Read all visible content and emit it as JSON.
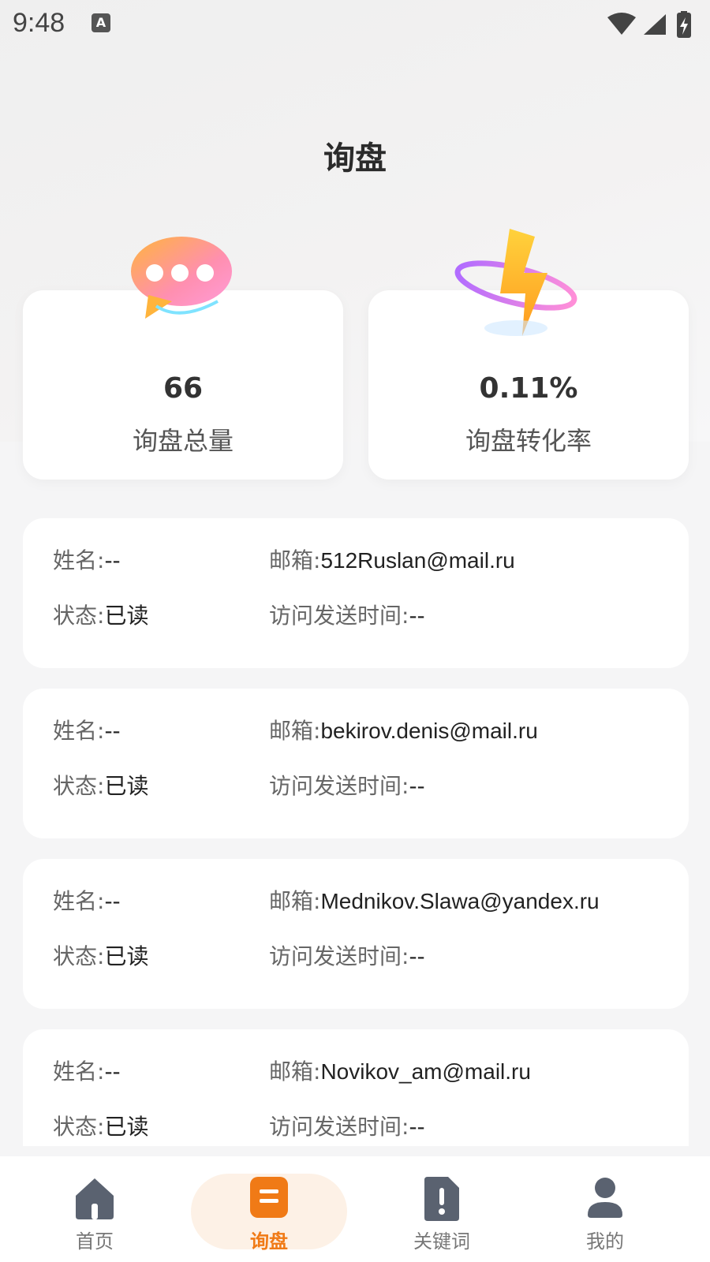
{
  "status_bar": {
    "time": "9:48",
    "indicator": "A"
  },
  "header": {
    "title": "询盘"
  },
  "stats": [
    {
      "value": "66",
      "label": "询盘总量",
      "icon": "chat-bubble-icon"
    },
    {
      "value": "0.11%",
      "label": "询盘转化率",
      "icon": "lightning-icon"
    }
  ],
  "field_labels": {
    "name": "姓名:",
    "email": "邮箱:",
    "status": "状态:",
    "time": "访问发送时间:"
  },
  "records": [
    {
      "name": "--",
      "email": "512Ruslan@mail.ru",
      "status": "已读",
      "time": "--"
    },
    {
      "name": "--",
      "email": "bekirov.denis@mail.ru",
      "status": "已读",
      "time": "--"
    },
    {
      "name": "--",
      "email": "Mednikov.Slawa@yandex.ru",
      "status": "已读",
      "time": "--"
    },
    {
      "name": "--",
      "email": "Novikov_am@mail.ru",
      "status": "已读",
      "time": "--"
    }
  ],
  "nav": {
    "items": [
      {
        "label": "首页",
        "icon": "home-icon"
      },
      {
        "label": "询盘",
        "icon": "inquiry-icon",
        "active": true
      },
      {
        "label": "关键词",
        "icon": "keyword-icon"
      },
      {
        "label": "我的",
        "icon": "user-icon"
      }
    ]
  },
  "colors": {
    "accent": "#f07a16",
    "nav_inactive": "#5a6270",
    "active_bg": "#fdf1e6"
  }
}
